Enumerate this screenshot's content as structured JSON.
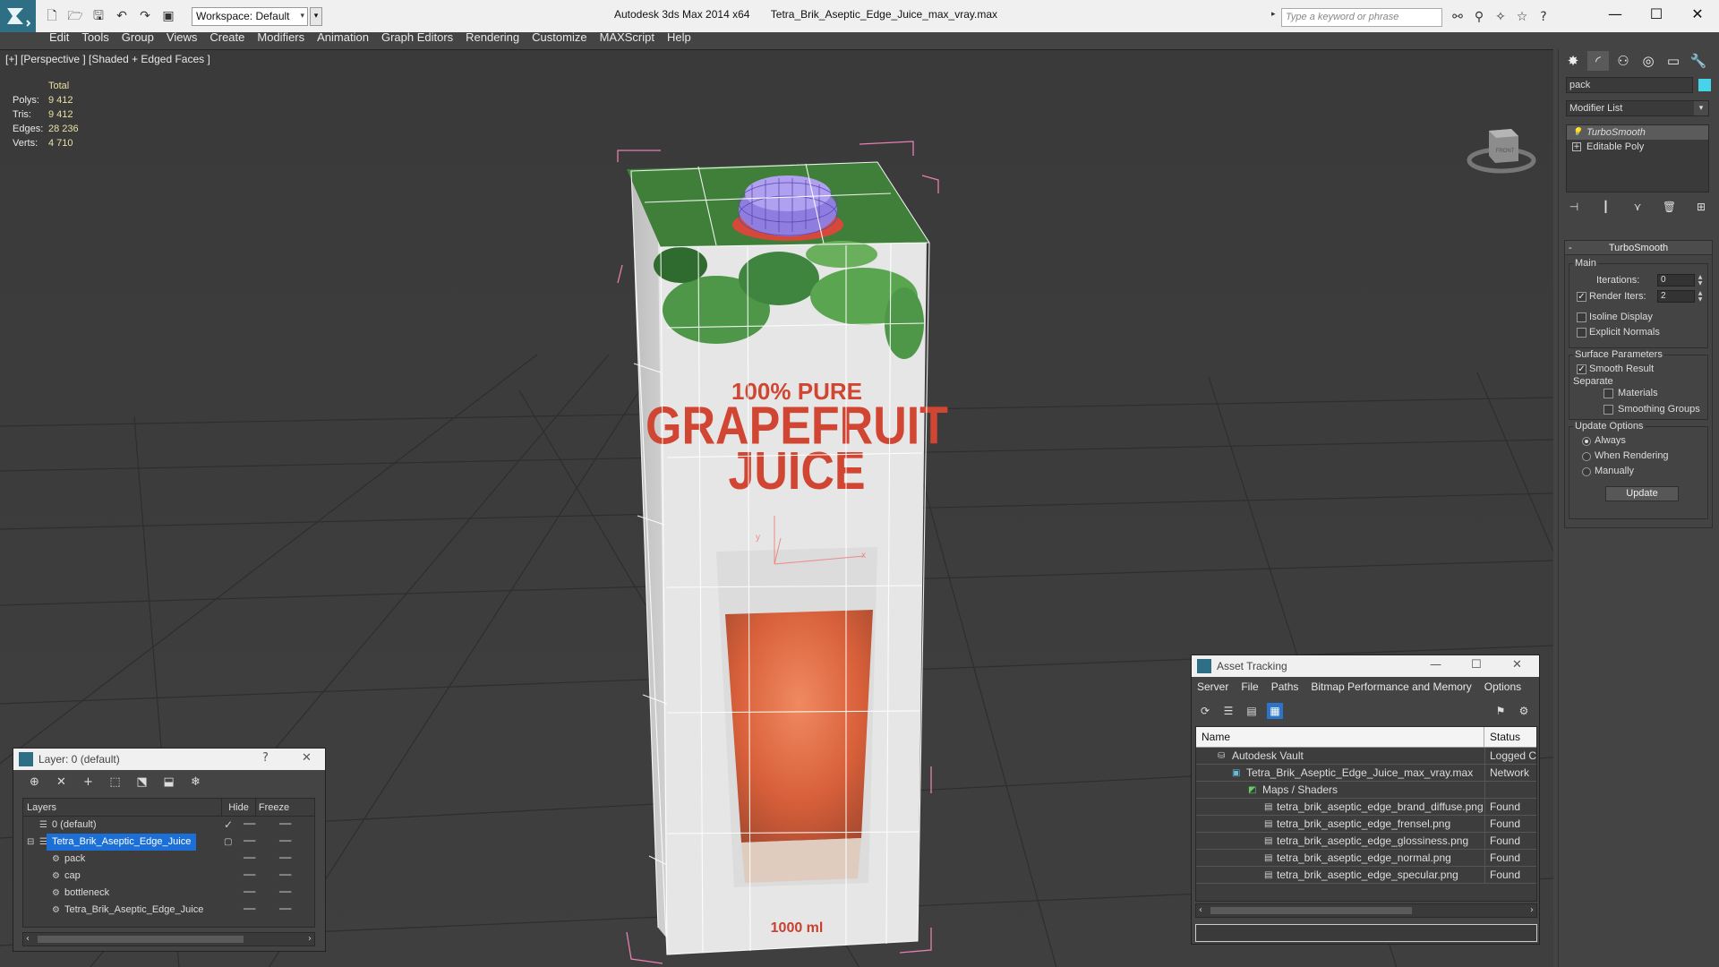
{
  "titlebar": {
    "workspace_label": "Workspace: Default",
    "app_name": "Autodesk 3ds Max  2014 x64",
    "file_name": "Tetra_Brik_Aseptic_Edge_Juice_max_vray.max",
    "search_placeholder": "Type a keyword or phrase"
  },
  "menu": [
    "Edit",
    "Tools",
    "Group",
    "Views",
    "Create",
    "Modifiers",
    "Animation",
    "Graph Editors",
    "Rendering",
    "Customize",
    "MAXScript",
    "Help"
  ],
  "viewport": {
    "label": "[+] [Perspective ] [Shaded + Edged Faces ]",
    "stats_header": "Total",
    "stats": [
      {
        "key": "Polys:",
        "value": "9 412"
      },
      {
        "key": "Tris:",
        "value": "9 412"
      },
      {
        "key": "Edges:",
        "value": "28 236"
      },
      {
        "key": "Verts:",
        "value": "4 710"
      }
    ],
    "product_text": {
      "line1": "100% PURE",
      "line2": "GRAPEFRUIT",
      "line3": "JUICE",
      "volume": "1000 ml"
    },
    "gizmo": {
      "y": "y",
      "x": "x"
    },
    "viewcube_label": "FRONT"
  },
  "command_panel": {
    "object_name": "pack",
    "object_color": "#47d4e8",
    "modifier_list_label": "Modifier List",
    "stack": [
      "TurboSmooth",
      "Editable Poly"
    ],
    "rollout_title": "TurboSmooth",
    "main_label": "Main",
    "iterations_label": "Iterations:",
    "iterations_value": "0",
    "render_iters_label": "Render Iters:",
    "render_iters_value": "2",
    "render_iters_checked": true,
    "isoline_label": "Isoline Display",
    "explicit_normals_label": "Explicit Normals",
    "surface_params_label": "Surface Parameters",
    "smooth_result_label": "Smooth Result",
    "smooth_result_checked": true,
    "separate_label": "Separate",
    "materials_label": "Materials",
    "smoothing_groups_label": "Smoothing Groups",
    "update_options_label": "Update Options",
    "update_always": "Always",
    "update_when_rendering": "When Rendering",
    "update_manually": "Manually",
    "update_button": "Update"
  },
  "layer_dialog": {
    "title": "Layer: 0 (default)",
    "help": "?",
    "columns": {
      "layers": "Layers",
      "hide": "Hide",
      "freeze": "Freeze"
    },
    "rows": [
      {
        "name": "0 (default)"
      },
      {
        "name": "Tetra_Brik_Aseptic_Edge_Juice"
      },
      {
        "name": "pack"
      },
      {
        "name": "cap"
      },
      {
        "name": "bottleneck"
      },
      {
        "name": "Tetra_Brik_Aseptic_Edge_Juice"
      }
    ]
  },
  "asset_tracking": {
    "title": "Asset Tracking",
    "menu": [
      "Server",
      "File",
      "Paths",
      "Bitmap Performance and Memory",
      "Options"
    ],
    "columns": {
      "name": "Name",
      "status": "Status"
    },
    "rows": [
      {
        "name": "Autodesk Vault",
        "status": "Logged C"
      },
      {
        "name": "Tetra_Brik_Aseptic_Edge_Juice_max_vray.max",
        "status": "Network"
      },
      {
        "name": "Maps / Shaders",
        "status": ""
      },
      {
        "name": "tetra_brik_aseptic_edge_brand_diffuse.png",
        "status": "Found"
      },
      {
        "name": "tetra_brik_aseptic_edge_frensel.png",
        "status": "Found"
      },
      {
        "name": "tetra_brik_aseptic_edge_glossiness.png",
        "status": "Found"
      },
      {
        "name": "tetra_brik_aseptic_edge_normal.png",
        "status": "Found"
      },
      {
        "name": "tetra_brik_aseptic_edge_specular.png",
        "status": "Found"
      }
    ]
  }
}
